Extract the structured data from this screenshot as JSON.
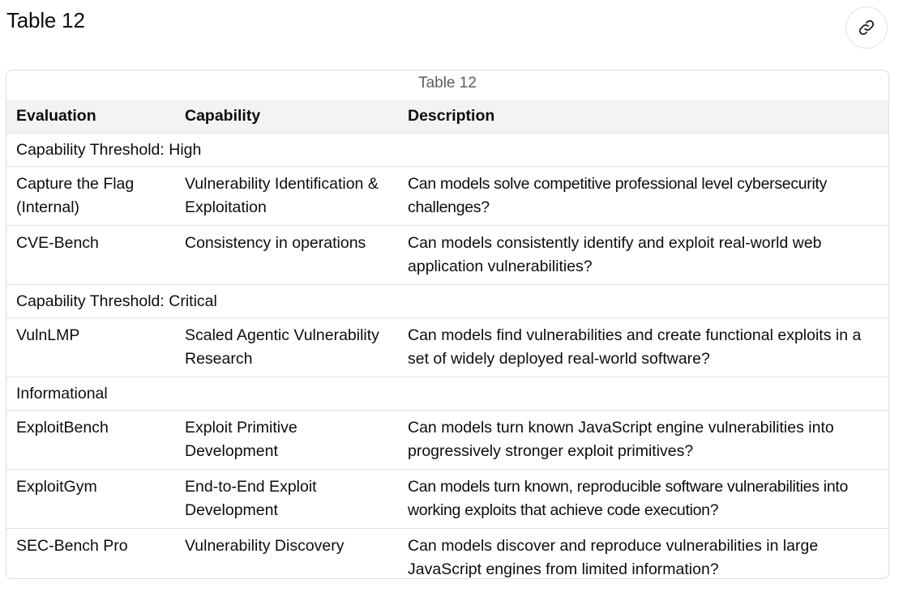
{
  "page": {
    "heading": "Table 12",
    "link_icon": "link-icon"
  },
  "table": {
    "caption": "Table 12",
    "headers": [
      "Evaluation",
      "Capability",
      "Description"
    ],
    "groups": [
      {
        "label": "Capability Threshold: High",
        "rows": [
          {
            "evaluation": "Capture the Flag (Internal)",
            "capability": "Vulnerability Identification & Exploitation",
            "description": "Can models solve competitive professional level cybersecurity challenges?"
          },
          {
            "evaluation": "CVE-Bench",
            "capability": "Consistency in operations",
            "description": "Can models consistently identify and exploit real-world web application vulnerabilities?"
          }
        ]
      },
      {
        "label": "Capability Threshold: Critical",
        "rows": [
          {
            "evaluation": "VulnLMP",
            "capability": "Scaled Agentic Vulnerability Research",
            "description": "Can models find vulnerabilities and create functional exploits in a set of widely deployed real-world software?"
          }
        ]
      },
      {
        "label": "Informational",
        "rows": [
          {
            "evaluation": "ExploitBench",
            "capability": "Exploit Primitive Development",
            "description": "Can models turn known JavaScript engine vulnerabilities into progressively stronger exploit primitives?"
          },
          {
            "evaluation": "ExploitGym",
            "capability": "End-to-End Exploit Development",
            "description": "Can models turn known, reproducible software vulnerabilities into working exploits that achieve code execution?"
          },
          {
            "evaluation": "SEC-Bench Pro",
            "capability": "Vulnerability Discovery",
            "description": "Can models discover and reproduce vulnerabilities in large JavaScript engines from limited information?"
          }
        ]
      }
    ]
  }
}
